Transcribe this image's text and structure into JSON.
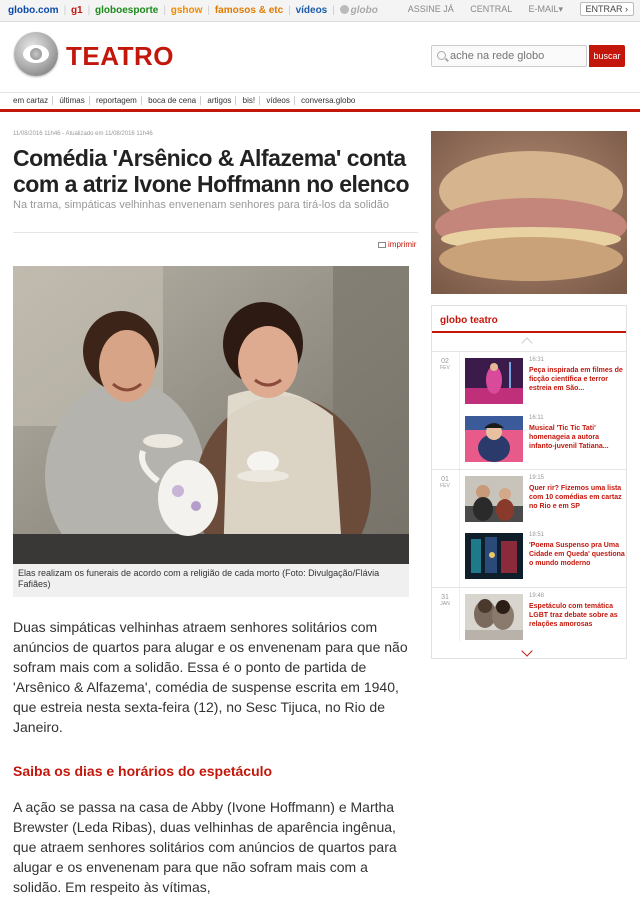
{
  "topbar": {
    "links": [
      "globo.com",
      "g1",
      "globoesporte",
      "gshow",
      "famosos & etc",
      "vídeos"
    ],
    "globoplay_logo_text": "globo",
    "right": [
      "ASSINE JÁ",
      "CENTRAL",
      "E-MAIL▾"
    ],
    "login_label": "ENTRAR ›"
  },
  "header": {
    "section_title": "TEATRO",
    "search_placeholder": "ache na rede globo",
    "search_button": "buscar"
  },
  "nav": {
    "items": [
      "em cartaz",
      "últimas",
      "reportagem",
      "boca de cena",
      "artigos",
      "bis!",
      "vídeos",
      "conversa.globo"
    ]
  },
  "article": {
    "meta": "11/08/2016 11h46 - Atualizado em 11/08/2016 11h46",
    "headline": "Comédia 'Arsênico & Alfazema' conta com a atriz Ivone Hoffmann no elenco",
    "subhead": "Na trama, simpáticas velhinhas envenenam senhores para tirá-los da solidão",
    "print_label": "imprimir",
    "caption": "Elas realizam os funerais de acordo com a religião de cada morto (Foto: Divulgação/Flávia Fafiães)",
    "para1": "Duas simpáticas velhinhas atraem senhores solitários com anúncios de quartos para alugar e os envenenam para que não sofram mais com a solidão. Essa é o ponto de partida de 'Arsênico & Alfazema', comédia de suspense escrita em 1940, que estreia nesta sexta-feira (12), no Sesc Tijuca, no Rio de Janeiro.",
    "subtitle": "Saiba os dias e horários do espetáculo",
    "para2": "A ação se passa na casa de Abby (Ivone Hoffmann) e Martha Brewster (Leda Ribas), duas velhinhas de aparência ingênua, que atraem senhores solitários com anúncios de quartos para alugar e os envenenam para que não sofram mais com a solidão. Em respeito às vítimas,"
  },
  "sidebar": {
    "widget_title": "globo teatro",
    "days": [
      {
        "day": "02",
        "month": "FEV"
      },
      {
        "day": "01",
        "month": "FEV"
      },
      {
        "day": "31",
        "month": "JAN"
      }
    ],
    "items": [
      {
        "time": "16:31",
        "title": "Peça inspirada em filmes de ficção científica e terror estreia em São..."
      },
      {
        "time": "16:11",
        "title": "Musical 'Tic Tic Tati' homenageia a autora infanto-juvenil Tatiana..."
      },
      {
        "time": "19:15",
        "title": "Quer rir? Fizemos uma lista com 10 comédias em cartaz no Rio e em SP"
      },
      {
        "time": "18:51",
        "title": "'Poema Suspenso pra Uma Cidade em Queda' questiona o mundo moderno"
      },
      {
        "time": "19:48",
        "title": "Espetáculo com temática LGBT traz debate sobre as relações amorosas"
      }
    ]
  },
  "colors": {
    "brand_red": "#c4170c"
  }
}
